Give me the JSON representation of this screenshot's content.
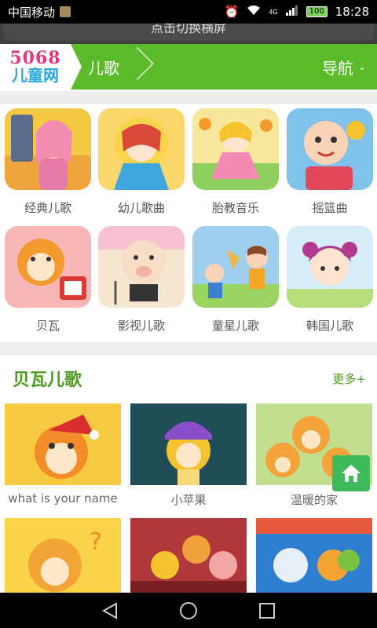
{
  "status": {
    "carrier": "中国移动",
    "battery": "100",
    "time": "18:28",
    "net": "4G"
  },
  "banner": {
    "text": "点击切换横屏"
  },
  "navbar": {
    "logo_num": "5068",
    "logo_name": "儿童网",
    "crumb": "儿歌",
    "nav": "导航",
    "nav_icon": "chevron-down-icon"
  },
  "categories": [
    {
      "label": "经典儿歌",
      "color": "#f4c842"
    },
    {
      "label": "幼儿歌曲",
      "color": "#f6b9c6"
    },
    {
      "label": "胎教音乐",
      "color": "#f7e79a"
    },
    {
      "label": "摇篮曲",
      "color": "#7fc2ea"
    },
    {
      "label": "贝瓦",
      "color": "#f7b7b7"
    },
    {
      "label": "影视儿歌",
      "color": "#f4e6cf"
    },
    {
      "label": "童星儿歌",
      "color": "#9ed0ee"
    },
    {
      "label": "韩国儿歌",
      "color": "#d6ecf7"
    }
  ],
  "section": {
    "title": "贝瓦儿歌",
    "more": "更多+"
  },
  "videos": [
    {
      "label": "what is your name",
      "color": "#f9d04a"
    },
    {
      "label": "小苹果",
      "color": "#1e4c56"
    },
    {
      "label": "温暖的家",
      "color": "#bedc8c"
    },
    {
      "label": "",
      "color": "#f9d04a"
    },
    {
      "label": "",
      "color": "#b5363a"
    },
    {
      "label": "",
      "color": "#3a8cd6"
    }
  ],
  "colors": {
    "brand": "#5aba2a",
    "accent": "#4a9a1c",
    "home": "#3fba5a"
  }
}
